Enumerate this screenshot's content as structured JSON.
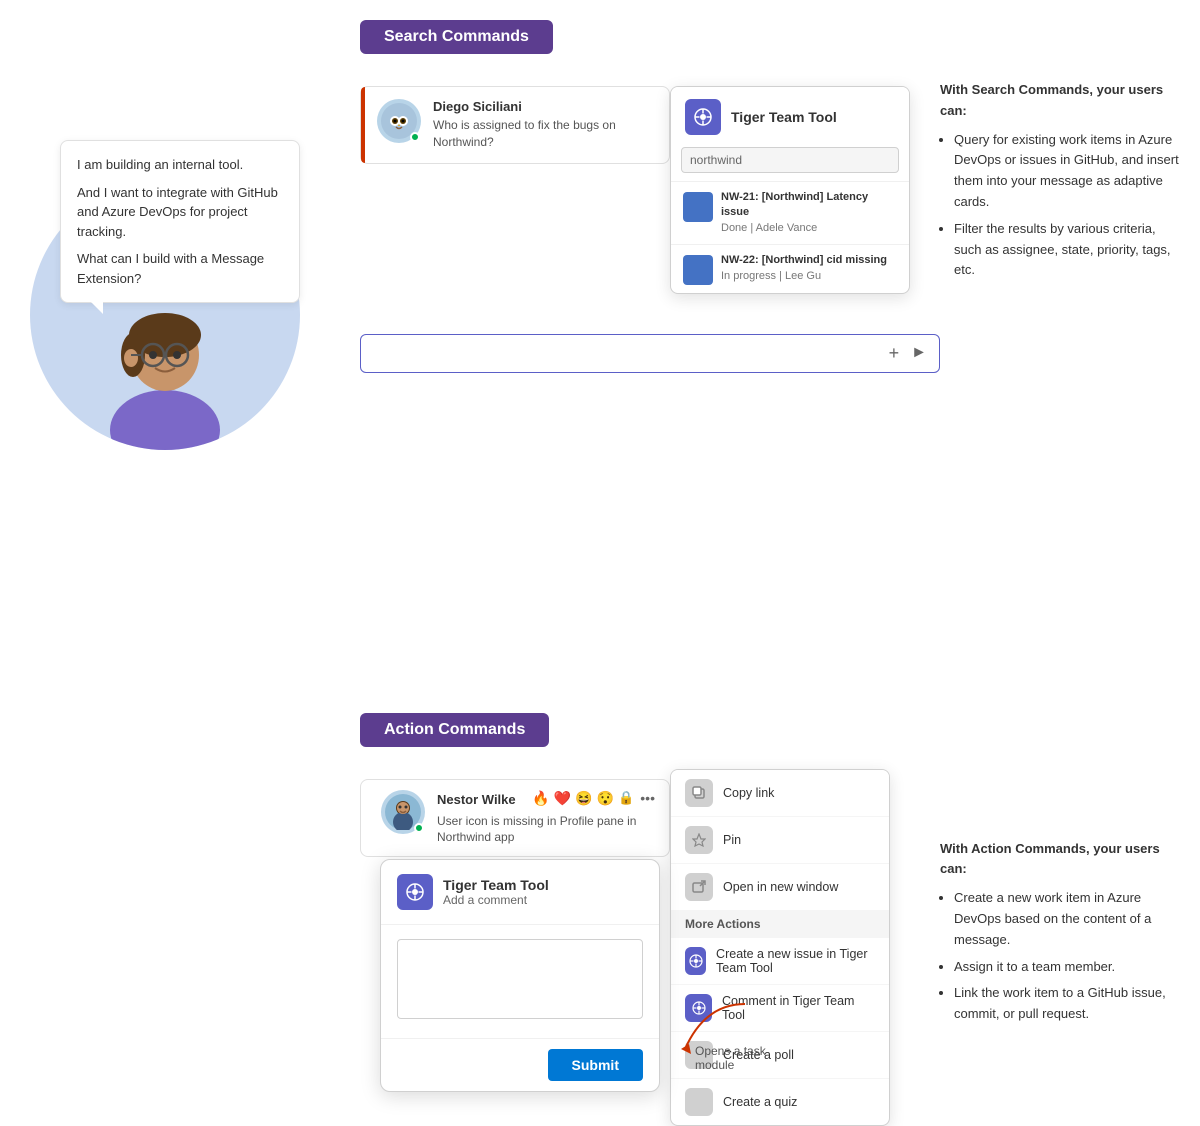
{
  "avatar": {
    "bubble_lines": [
      "I am building an internal tool.",
      "And I want to integrate with GitHub and Azure DevOps for project tracking.",
      "What can I build with a Message Extension?"
    ]
  },
  "search_commands": {
    "label": "Search Commands",
    "chat": {
      "name": "Diego Siciliani",
      "message": "Who is assigned to fix the bugs on Northwind?"
    },
    "teams_popup": {
      "app_name": "Tiger Team Tool",
      "search_placeholder": "northwind",
      "results": [
        {
          "title": "NW-21: [Northwind] Latency issue",
          "subtitle": "Done | Adele Vance"
        },
        {
          "title": "NW-22: [Northwind] cid missing",
          "subtitle": "In progress | Lee Gu"
        }
      ]
    },
    "description": {
      "title": "With Search Commands, your users can:",
      "bullets": [
        "Query for existing work items in Azure DevOps or issues in GitHub, and insert them into your message as adaptive cards.",
        "Filter the results by various criteria, such as assignee, state, priority, tags, etc."
      ]
    }
  },
  "action_commands": {
    "label": "Action Commands",
    "chat": {
      "name": "Nestor Wilke",
      "message": "User icon is missing in Profile pane in Northwind app",
      "reactions": [
        "🔥",
        "❤️",
        "😆",
        "😯",
        "🔒"
      ]
    },
    "context_menu": {
      "items": [
        {
          "label": "Create a new issue in Tiger Team Tool",
          "icon_type": "purple"
        },
        {
          "label": "Comment in Tiger Team Tool",
          "icon_type": "purple"
        },
        {
          "label": "Create a poll",
          "icon_type": "gray"
        },
        {
          "label": "Create a quiz",
          "icon_type": "gray"
        }
      ],
      "more_actions_label": "More Actions",
      "more_items": [
        {
          "label": "Copy link"
        },
        {
          "label": "Pin"
        },
        {
          "label": "Open in new window"
        }
      ]
    },
    "task_module": {
      "app_name": "Tiger Team Tool",
      "subtitle": "Add a comment",
      "submit_label": "Submit"
    },
    "opens_task_label": "Opens a task module",
    "description": {
      "title": "With Action Commands, your users can:",
      "bullets": [
        "Create a new work item in Azure DevOps based on the content of a message.",
        "Assign it to a team member.",
        "Link the work item to a GitHub issue, commit, or pull request."
      ]
    }
  }
}
